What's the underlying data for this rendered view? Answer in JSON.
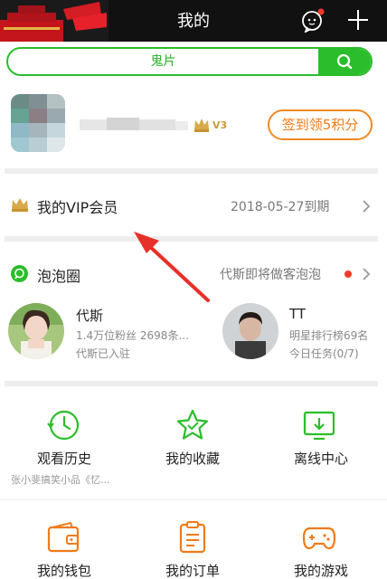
{
  "header": {
    "title": "我的",
    "icons": [
      "message-icon",
      "plus-icon"
    ]
  },
  "search": {
    "text": "鬼片"
  },
  "profile": {
    "level_badge": "V3",
    "checkin_label": "签到领5积分"
  },
  "vip": {
    "label": "我的VIP会员",
    "expiry": "2018-05-27到期"
  },
  "bubble": {
    "title": "泡泡圈",
    "notice": "代斯即将做客泡泡",
    "stars": [
      {
        "name": "代斯",
        "line1": "1.4万位粉丝 2698条...",
        "line2": "代斯已入驻"
      },
      {
        "name": "TT",
        "line1": "明星排行榜69名",
        "line2": "今日任务(0/7)"
      }
    ]
  },
  "grid": [
    {
      "label": "观看历史",
      "sub": "张小斐搞笑小品《忆...",
      "icon": "history-icon"
    },
    {
      "label": "我的收藏",
      "sub": "",
      "icon": "favorite-star-icon"
    },
    {
      "label": "离线中心",
      "sub": "",
      "icon": "download-icon"
    },
    {
      "label": "我的钱包",
      "sub": "",
      "icon": "wallet-icon"
    },
    {
      "label": "我的订单",
      "sub": "",
      "icon": "order-icon"
    },
    {
      "label": "我的游戏",
      "sub": "",
      "icon": "gamepad-icon"
    }
  ],
  "colors": {
    "green": "#2bbd2b",
    "orange": "#f07a18",
    "header": "#111111",
    "accent_red": "#f23a2a"
  }
}
